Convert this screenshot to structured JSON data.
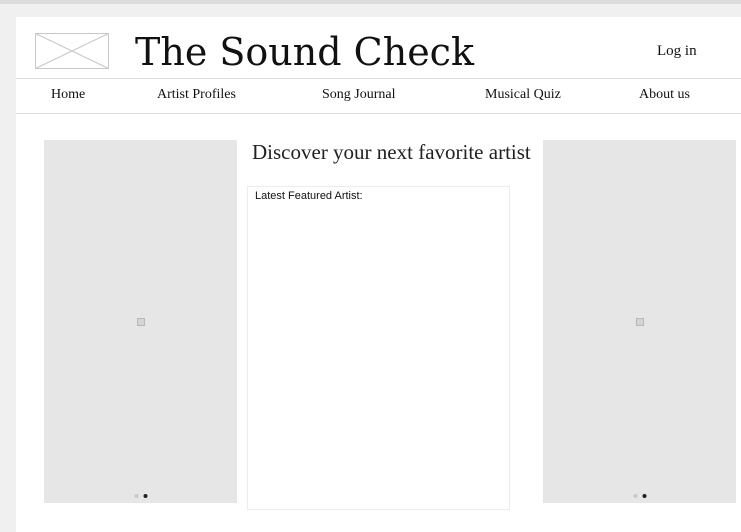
{
  "header": {
    "site_title": "The Sound Check",
    "login_label": "Log in"
  },
  "nav": {
    "items": [
      {
        "label": "Home"
      },
      {
        "label": "Artist Profiles"
      },
      {
        "label": "Song Journal"
      },
      {
        "label": "Musical Quiz"
      },
      {
        "label": "About us"
      }
    ]
  },
  "main": {
    "headline": "Discover your next favorite artist",
    "featured_label": "Latest Featured Artist:"
  },
  "carousels": {
    "left": {
      "dot_count": 2,
      "active_dot": 2,
      "icon": "image-placeholder-icon"
    },
    "right": {
      "dot_count": 2,
      "active_dot": 2,
      "icon": "image-placeholder-icon"
    }
  },
  "colors": {
    "page_background": "#f0f0f0",
    "content_background": "#ffffff",
    "placeholder_gray": "#e6e6e6",
    "text": "#111111"
  }
}
